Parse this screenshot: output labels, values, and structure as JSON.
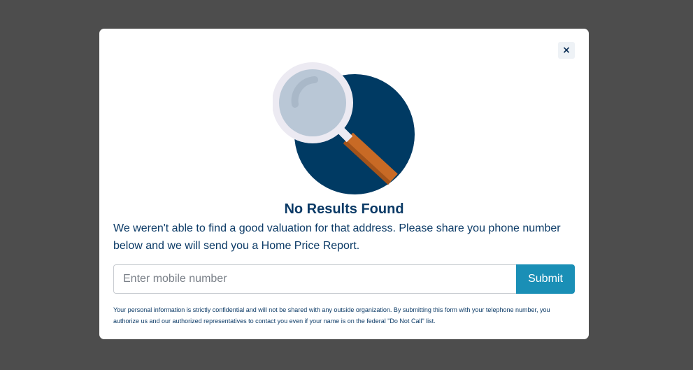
{
  "modal": {
    "close_label": "×",
    "illustration_icon": "magnifying-glass-icon",
    "title": "No Results Found",
    "message": "We weren't able to find a good valuation for that address. Please share you phone number below and we will send you a Home Price Report.",
    "phone_input": {
      "value": "",
      "placeholder": "Enter mobile number"
    },
    "submit_label": "Submit",
    "disclaimer": "Your personal information is strictly confidential and will not be shared with any outside organization. By submitting this form with your telephone number, you authorize us and our authorized representatives to contact you even if your name is on the federal \"Do Not Call\" list."
  },
  "colors": {
    "backdrop": "#4d4d4d",
    "modal_bg": "#ffffff",
    "text_primary": "#0b3a66",
    "submit_bg": "#1a8fb6",
    "circle": "#003a63",
    "handle": "#b35f22",
    "lens": "#b9c7d6"
  }
}
